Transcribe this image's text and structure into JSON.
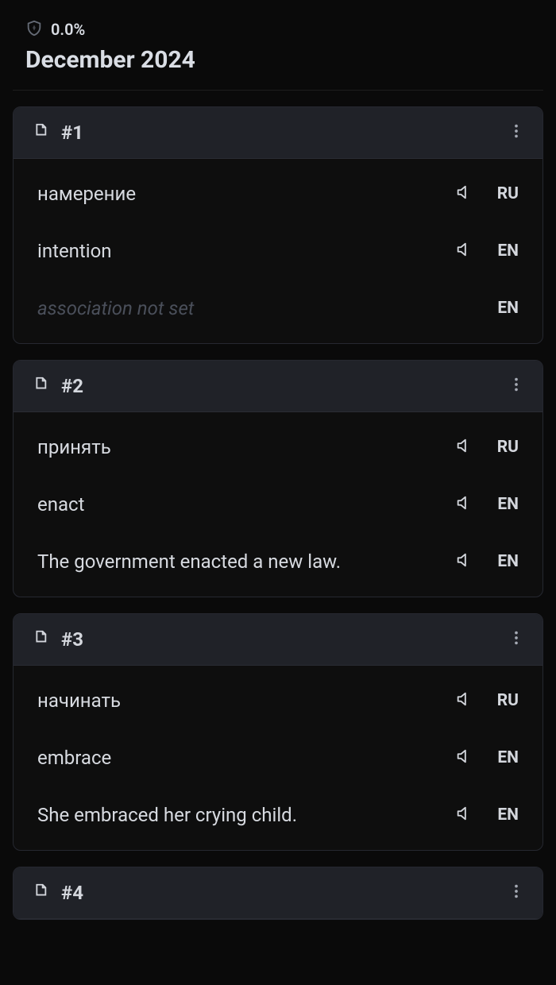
{
  "header": {
    "progress": "0.0%",
    "date": "December 2024"
  },
  "cards": [
    {
      "number": "#1",
      "rows": [
        {
          "text": "намерение",
          "lang": "RU",
          "speaker": true,
          "placeholder": false
        },
        {
          "text": "intention",
          "lang": "EN",
          "speaker": true,
          "placeholder": false
        },
        {
          "text": "association not set",
          "lang": "EN",
          "speaker": false,
          "placeholder": true
        }
      ]
    },
    {
      "number": "#2",
      "rows": [
        {
          "text": "принять",
          "lang": "RU",
          "speaker": true,
          "placeholder": false
        },
        {
          "text": "enact",
          "lang": "EN",
          "speaker": true,
          "placeholder": false
        },
        {
          "text": "The government enacted a new law.",
          "lang": "EN",
          "speaker": true,
          "placeholder": false
        }
      ]
    },
    {
      "number": "#3",
      "rows": [
        {
          "text": "начинать",
          "lang": "RU",
          "speaker": true,
          "placeholder": false
        },
        {
          "text": "embrace",
          "lang": "EN",
          "speaker": true,
          "placeholder": false
        },
        {
          "text": "She embraced her crying child.",
          "lang": "EN",
          "speaker": true,
          "placeholder": false
        }
      ]
    },
    {
      "number": "#4",
      "rows": []
    }
  ]
}
